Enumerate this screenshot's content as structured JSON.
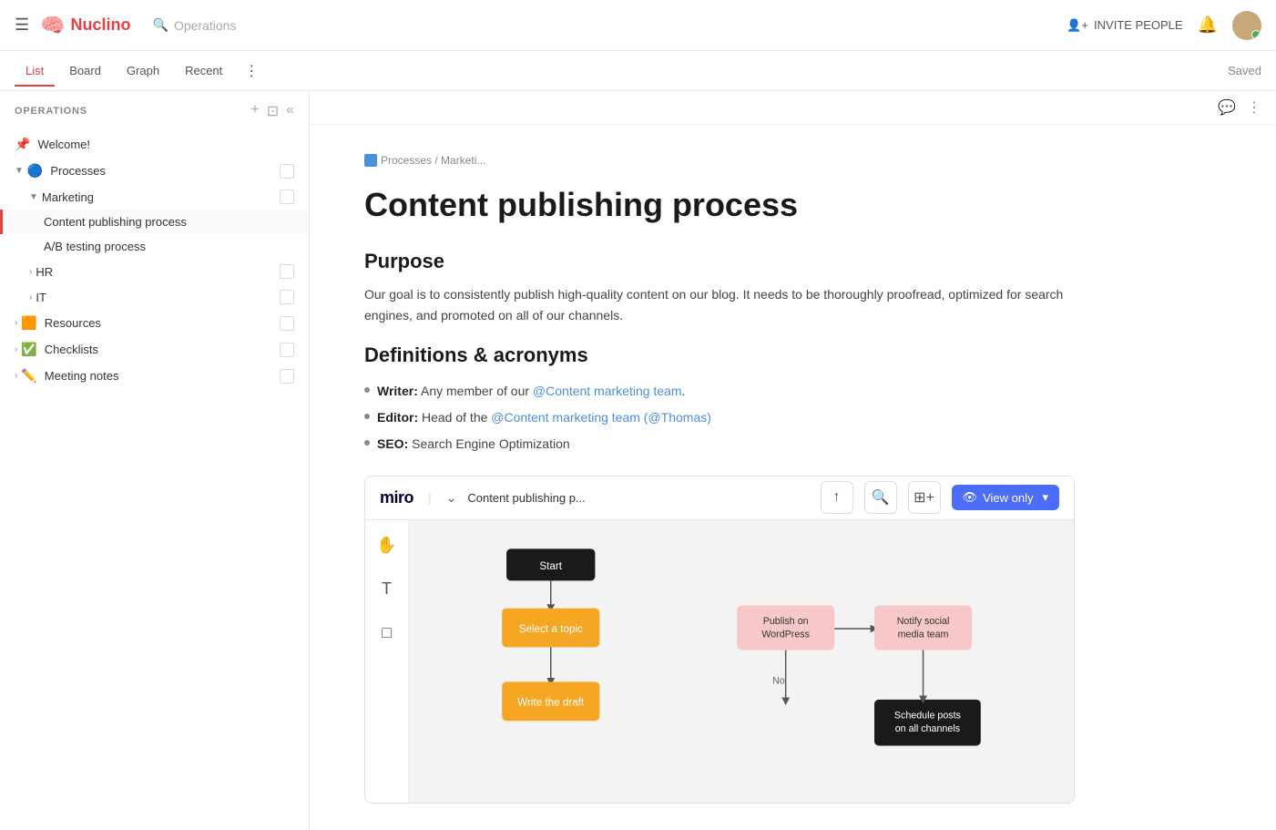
{
  "topbar": {
    "hamburger": "☰",
    "logo_text": "Nuclino",
    "search_placeholder": "Operations",
    "invite_label": "INVITE PEOPLE",
    "saved_label": "Saved"
  },
  "tabs": [
    {
      "label": "List",
      "active": true
    },
    {
      "label": "Board",
      "active": false
    },
    {
      "label": "Graph",
      "active": false
    },
    {
      "label": "Recent",
      "active": false
    }
  ],
  "sidebar": {
    "title": "OPERATIONS",
    "items": [
      {
        "id": "welcome",
        "label": "Welcome!",
        "icon": "📌",
        "indent": 0,
        "expandable": false
      },
      {
        "id": "processes",
        "label": "Processes",
        "icon": "🔵",
        "indent": 0,
        "expandable": true,
        "expanded": true
      },
      {
        "id": "marketing",
        "label": "Marketing",
        "icon": "",
        "indent": 1,
        "expandable": true,
        "expanded": true
      },
      {
        "id": "content-publishing",
        "label": "Content publishing process",
        "icon": "",
        "indent": 2,
        "expandable": false,
        "active": true
      },
      {
        "id": "ab-testing",
        "label": "A/B testing process",
        "icon": "",
        "indent": 2,
        "expandable": false
      },
      {
        "id": "hr",
        "label": "HR",
        "icon": "",
        "indent": 1,
        "expandable": true,
        "expanded": false
      },
      {
        "id": "it",
        "label": "IT",
        "icon": "",
        "indent": 1,
        "expandable": true,
        "expanded": false
      },
      {
        "id": "resources",
        "label": "Resources",
        "icon": "🟧",
        "indent": 0,
        "expandable": true
      },
      {
        "id": "checklists",
        "label": "Checklists",
        "icon": "✅",
        "indent": 0,
        "expandable": true
      },
      {
        "id": "meeting-notes",
        "label": "Meeting notes",
        "icon": "✏️",
        "indent": 0,
        "expandable": true
      }
    ]
  },
  "breadcrumb": {
    "icon": "🔵",
    "path": "Processes / Marketi..."
  },
  "document": {
    "title": "Content publishing process",
    "sections": [
      {
        "heading": "Purpose",
        "content": "Our goal is to consistently publish high-quality content on our blog. It needs to be thoroughly proofread, optimized for search engines, and promoted on all of our channels."
      },
      {
        "heading": "Definitions & acronyms",
        "bullets": [
          {
            "label": "Writer:",
            "text": " Any member of our ",
            "link": "@Content marketing team",
            "after": "."
          },
          {
            "label": "Editor:",
            "text": " Head of the ",
            "link": "@Content marketing team",
            "link2": " (@Thomas)",
            "after": ""
          },
          {
            "label": "SEO:",
            "text": " Search Engine Optimization",
            "link": "",
            "after": ""
          }
        ]
      }
    ]
  },
  "miro": {
    "logo": "miro",
    "doc_name": "Content publishing p...",
    "view_only_label": "View only",
    "flow_nodes": {
      "start": "Start",
      "select_topic": "Select a topic",
      "write_draft": "Write the draft",
      "publish_wordpress": "Publish on WordPress",
      "notify_social": "Notify social media team",
      "schedule_posts": "Schedule posts on all channels",
      "no_label": "No"
    }
  }
}
